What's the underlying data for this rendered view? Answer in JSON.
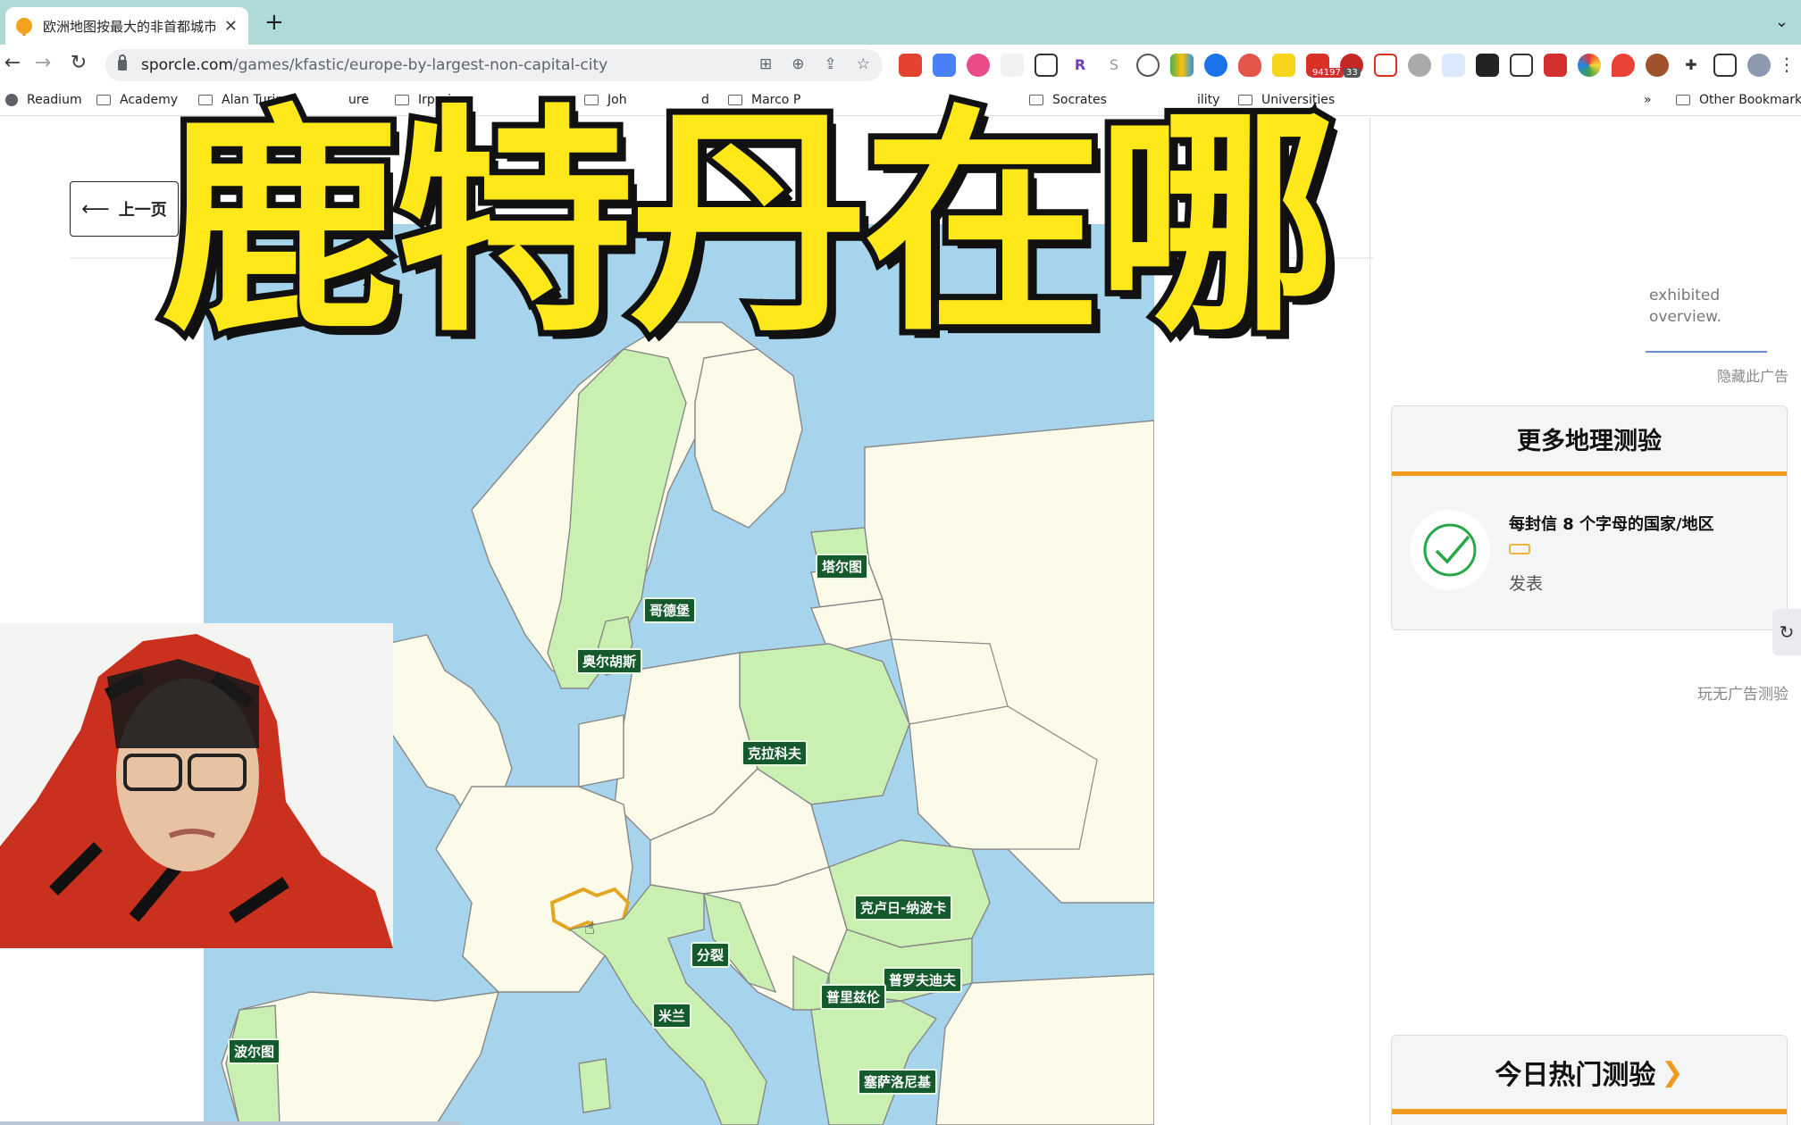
{
  "browser": {
    "tab_title": "欧洲地图按最大的非首都城市测验",
    "url_domain": "sporcle.com",
    "url_path": "/games/kfastic/europe-by-largest-non-capital-city",
    "extension_badges": [
      "94197",
      "33"
    ],
    "bookmarks": [
      "Readium",
      "Academy",
      "Alan Turin",
      "ure",
      "Irperius",
      "Joh",
      "d",
      "Marco P",
      "Socrates",
      "ility",
      "Universities",
      "»",
      "Other Bookmarks"
    ]
  },
  "page": {
    "prev_button": "上一页",
    "exhibited_text": [
      "exhibited",
      "overview."
    ],
    "hide_ad": "隐藏此广告",
    "more_quizzes_title": "更多地理测验",
    "quiz_item_name": "每封信 8 个字母的国家/地区",
    "quiz_item_status": "发表",
    "ad_free": "玩无广告测验",
    "hot_today_title": "今日热门测验",
    "hot_today_chevron": "❯"
  },
  "map": {
    "cities": [
      {
        "name": "塔尔图",
        "country": "Estonia"
      },
      {
        "name": "哥德堡",
        "country": "Sweden"
      },
      {
        "name": "奥尔胡斯",
        "country": "Denmark"
      },
      {
        "name": "克拉科夫",
        "country": "Poland"
      },
      {
        "name": "克卢日-纳波卡",
        "country": "Romania"
      },
      {
        "name": "分裂",
        "country": "Croatia"
      },
      {
        "name": "普罗夫迪夫",
        "country": "Bulgaria"
      },
      {
        "name": "普里兹伦",
        "country": "Kosovo"
      },
      {
        "name": "米兰",
        "country": "Italy"
      },
      {
        "name": "波尔图",
        "country": "Portugal"
      },
      {
        "name": "塞萨洛尼基",
        "country": "Greece"
      }
    ],
    "highlighted_country": "Switzerland",
    "colors": {
      "sea": "#a6d4ec",
      "land": "#fcfbe9",
      "answered": "#c9efb1",
      "highlight": "#e2a623"
    }
  },
  "overlay": {
    "video_title": "鹿特丹在哪"
  }
}
